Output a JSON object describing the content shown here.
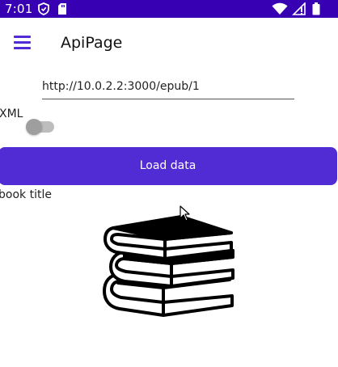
{
  "status_bar": {
    "time": "7:01",
    "left_icons": [
      "shield-icon",
      "sd-card-icon"
    ],
    "right_icons": [
      "wifi-icon",
      "signal-icon",
      "battery-icon"
    ],
    "background": "#3700b3"
  },
  "app_bar": {
    "menu_icon": "hamburger-menu-icon",
    "title": "ApiPage"
  },
  "url_entry": {
    "value": "http://10.0.2.2:3000/epub/1"
  },
  "xml_toggle": {
    "label": "XML",
    "state": "off"
  },
  "load_button": {
    "label": "Load data",
    "color": "#512bd4"
  },
  "book": {
    "title_label": "book title",
    "image_icon": "books-stack-icon"
  }
}
